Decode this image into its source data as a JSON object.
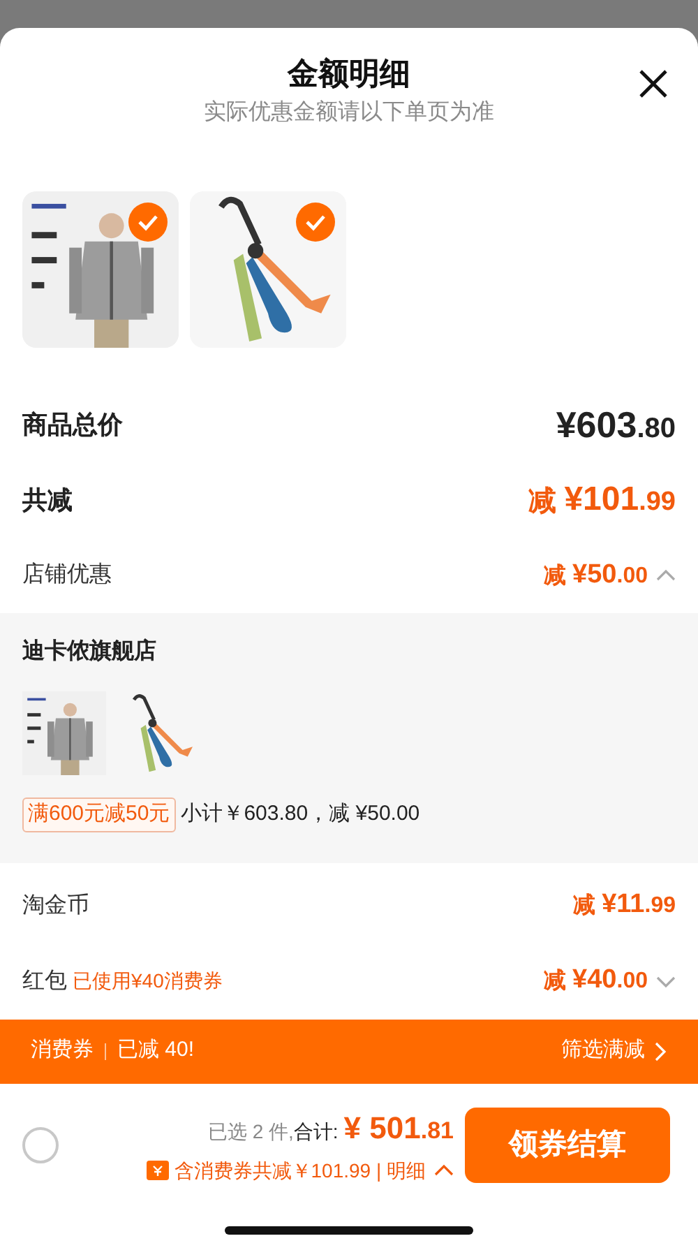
{
  "header": {
    "title": "金额明细",
    "subtitle": "实际优惠金额请以下单页为准"
  },
  "products": [
    {
      "kind": "picture",
      "checked": true
    },
    {
      "kind": "picture",
      "checked": true
    }
  ],
  "summary_rows": [
    {
      "label": "商品总价",
      "kind": "total",
      "amount": {
        "main": "¥603",
        "decimals": ".80"
      }
    },
    {
      "label": "共减",
      "kind": "savings",
      "amount": {
        "prefix": "减 ",
        "main": "¥101",
        "decimals": ".99"
      }
    },
    {
      "label": "店铺优惠",
      "kind": "discount",
      "expanded": true,
      "amount": {
        "prefix": "减 ",
        "main": "¥50",
        "decimals": ".00"
      }
    }
  ],
  "store_detail": {
    "store_name": "迪卡侬旗舰店",
    "thumbnails": [
      {
        "kind": "picture"
      },
      {
        "kind": "picture"
      }
    ],
    "promo_tag": "满600元减50元",
    "subtotal": "小计￥603.80，减 ¥50.00"
  },
  "other_rows": [
    {
      "label": "淘金币",
      "kind": "discount",
      "amount": {
        "prefix": "减 ",
        "main": "¥11",
        "decimals": ".99"
      }
    },
    {
      "label": "红包",
      "note": "已使用¥40消费券",
      "kind": "discount",
      "expanded": false,
      "amount": {
        "prefix": "减 ",
        "main": "¥40",
        "decimals": ".00"
      }
    }
  ],
  "banner": {
    "label": "消费券",
    "message": "已减 40!",
    "link": "筛选满减"
  },
  "footer": {
    "select_all": {
      "selected": false
    },
    "selected_count": "已选 2 件,",
    "total_label": "合计:",
    "total": {
      "main": "¥ 501",
      "decimals": ".81"
    },
    "savings": "含消费券共减￥101.99 | 明细",
    "savings_expanded": false,
    "checkout": "领券结算"
  }
}
